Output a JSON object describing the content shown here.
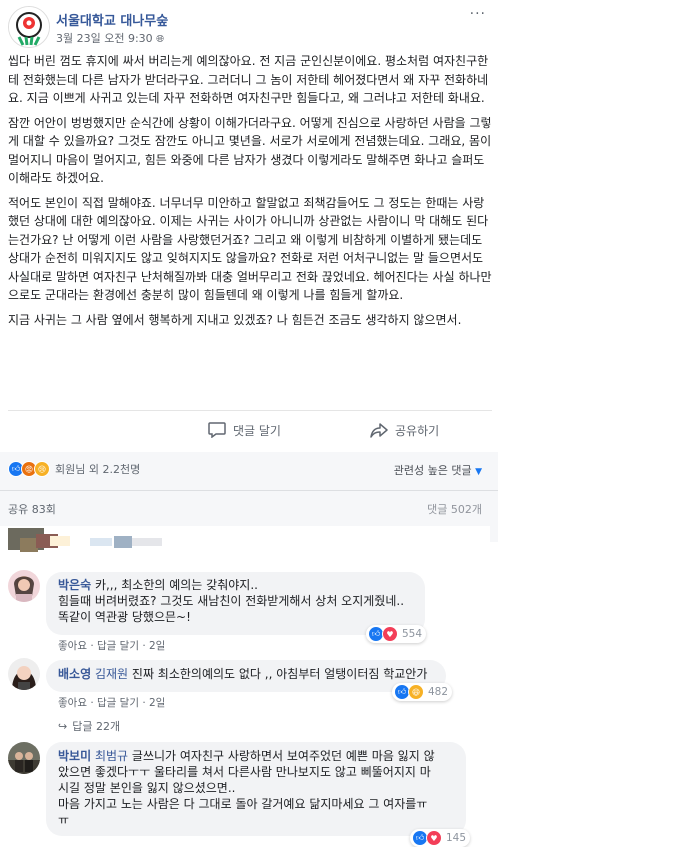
{
  "post": {
    "page_name": "서울대학교 대나무숲",
    "date": "3월 23일 오전 9:30",
    "more_icon": "ellipsis-icon",
    "paragraphs": [
      "씹다 버린 껌도 휴지에 싸서 버리는게 예의잖아요. 전 지금 군인신분이에요. 평소처럼 여자친구한테 전화했는데 다른 남자가 받더라구요. 그러더니 그 놈이 저한테 헤어졌다면서 왜 자꾸 전화하네요. 지금 이쁘게 사귀고 있는데 자꾸 전화하면 여자친구만 힘들다고, 왜 그러냐고 저한테 화내요.",
      "잠깐 어안이 벙벙했지만 순식간에 상황이 이해가더라구요. 어떻게 진심으로 사랑하던 사람을 그렇게 대할 수 있을까요? 그것도 잠깐도 아니고 몇년을. 서로가 서로에게 전념했는데요. 그래요, 몸이 멀어지니 마음이 멀어지고, 힘든 와중에 다른 남자가 생겼다 이렇게라도 말해주면 화나고 슬퍼도 이해라도 하겠어요.",
      "적어도 본인이 직접 말해야죠. 너무너무 미안하고 할말없고 죄책감들어도 그 정도는 한때는 사랑했던 상대에 대한 예의잖아요. 이제는 사귀는 사이가 아니니까 상관없는 사람이니 막 대해도 된다는건가요? 난 어떻게 이런 사람을 사랑했던거죠? 그리고 왜 이렇게 비참하게 이별하게 됐는데도 상대가 순전히 미워지지도 않고 잊혀지지도 않을까요? 전화로 저런 어처구니없는 말 들으면서도 사실대로 말하면 여자친구 난처해질까봐 대충 얼버무리고 전화 끊었네요. 헤어진다는 사실 하나만으로도 군대라는 환경에선 충분히 많이 힘들텐데 왜 이렇게 나를 힘들게 할까요.",
      "지금 사귀는 그 사람 옆에서 행복하게 지내고 있겠죠? 나 힘든건 조금도 생각하지 않으면서."
    ],
    "comment_action": "댓글 달기",
    "share_action": "공유하기",
    "reaction_summary": "회원님 외 2.2천명",
    "sort_label": "관련성 높은 댓글",
    "share_count": "공유 83회",
    "comment_count": "댓글 502개"
  },
  "comments": [
    {
      "author": "박은숙",
      "lines": [
        "카,,, 최소한의 예의는 갖춰야지..",
        "힘들때 버려버렸죠? 그것도 새남친이 전화받게해서 상처 오지게줬네..",
        "똑같이 역관광 당했으믄~!"
      ],
      "like": "좋아요",
      "reply": "답글 달기",
      "time": "2일",
      "reactions": "554"
    },
    {
      "author": "배소영",
      "tagged": "김재원",
      "text": "진짜 최소한의예의도 없다 ,, 아침부터 얼탱이터짐 학교안가",
      "like": "좋아요",
      "reply": "답글 달기",
      "time": "2일",
      "reactions": "482"
    },
    {
      "author": "박보미",
      "tagged": "최범규",
      "lines": [
        "글쓰니가 여자친구 사랑하면서 보여주었던 예쁜 마음 잃지 않",
        "았으면 좋겠다ㅜㅜ 울타리를 쳐서 다른사람 만나보지도 않고 삐뚤어지지 마",
        "시길 정말 본인을 잃지 않으셨으면..",
        "마음 가지고 노는 사람은 다 그대로 돌아 갈거예요 닮지마세요 그 여자를ㅠ",
        "ㅠ"
      ],
      "reactions": "145"
    }
  ],
  "replies_label": "답글 22개",
  "colors": {
    "link": "#365899",
    "bubble": "#f2f3f5",
    "like": "#1877f2",
    "love": "#f33e58",
    "haha": "#f7b125"
  }
}
